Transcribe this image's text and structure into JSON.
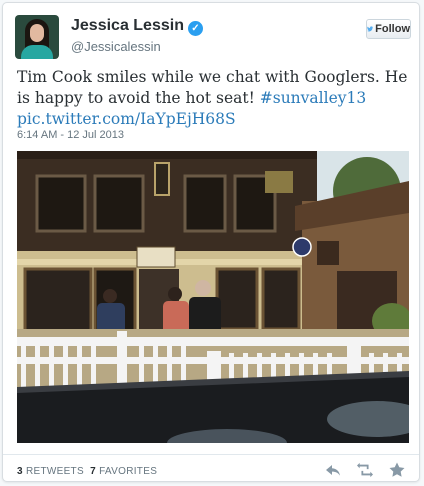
{
  "author": {
    "name": "Jessica Lessin",
    "handle": "@Jessicalessin",
    "verified": true
  },
  "follow_button": {
    "label": "Follow",
    "icon": "twitter-bird-icon"
  },
  "tweet": {
    "text_before": "Tim Cook smiles while we chat with Googlers. He is happy to avoid the hot seat! ",
    "hashtag": "#sunvalley13",
    "link": "pic.twitter.com/IaYpEjH68S",
    "timestamp": "6:14 AM - 12 Jul 2013"
  },
  "stats": {
    "retweets_count": "3",
    "retweets_label": "RETWEETS",
    "favorites_count": "7",
    "favorites_label": "FAVORITES"
  },
  "actions": [
    {
      "name": "reply-icon"
    },
    {
      "name": "retweet-icon"
    },
    {
      "name": "favorite-icon"
    }
  ],
  "colors": {
    "link": "#2b7bb9",
    "verified": "#2b9ff0",
    "muted_text": "#66757f"
  }
}
